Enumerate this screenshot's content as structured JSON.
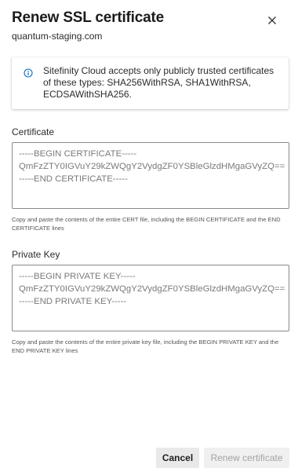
{
  "dialog": {
    "title": "Renew SSL certificate",
    "subtitle": "quantum-staging.com",
    "close_icon": "close-icon"
  },
  "info": {
    "icon": "info-icon",
    "text": "Sitefinity Cloud accepts only publicly trusted certificates of these types: SHA256WithRSA, SHA1WithRSA, ECDSAWithSHA256."
  },
  "certificate": {
    "label": "Certificate",
    "value": "-----BEGIN CERTIFICATE-----\nQmFzZTY0IGVuY29kZWQgY2VydgZF0YSBleGlzdHMgaGVyZQ==\n-----END CERTIFICATE-----",
    "help": "Copy and paste the contents of the entire CERT file, including the BEGIN CERTIFICATE and the END CERTIFICATE lines"
  },
  "private_key": {
    "label": "Private Key",
    "value": "-----BEGIN PRIVATE KEY-----\nQmFzZTY0IGVuY29kZWQgY2VydgZF0YSBleGlzdHMgaGVyZQ==\n-----END PRIVATE KEY-----",
    "help": "Copy and paste the contents of the entire private key file, including the BEGIN PRIVATE KEY and the END PRIVATE KEY lines"
  },
  "footer": {
    "cancel_label": "Cancel",
    "renew_label": "Renew certificate",
    "renew_disabled": true
  }
}
